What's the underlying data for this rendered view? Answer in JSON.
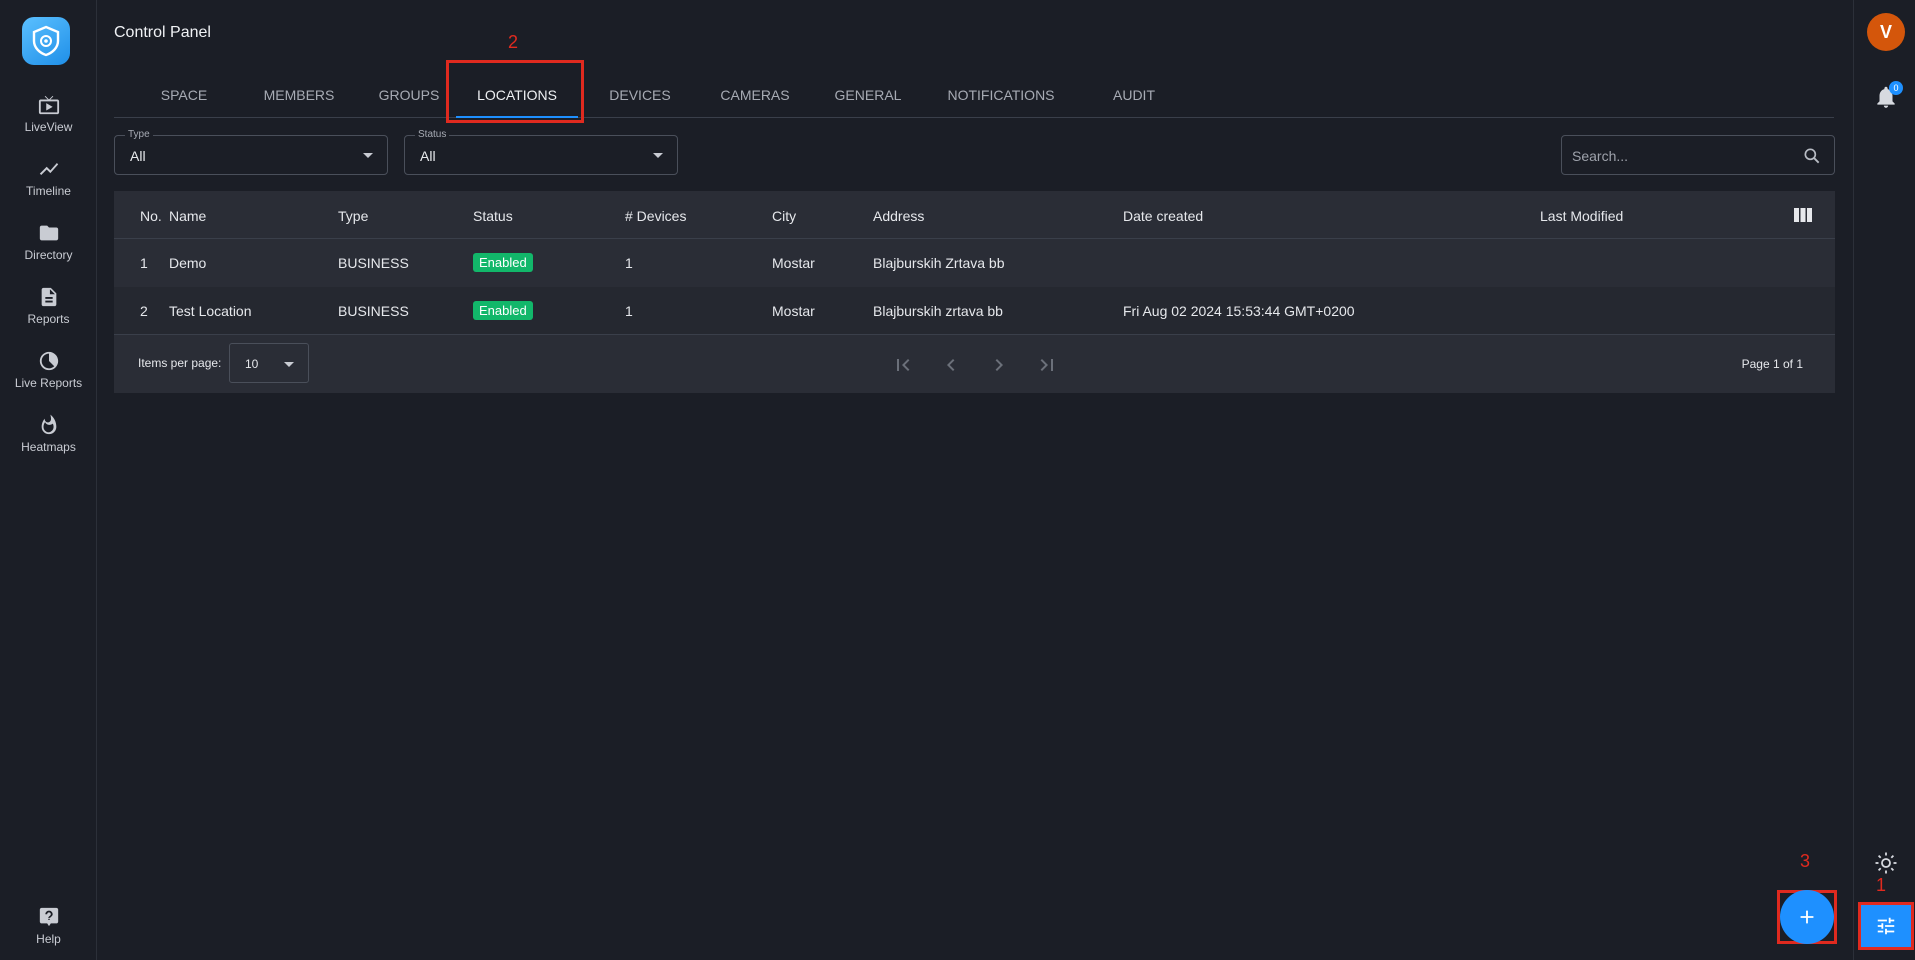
{
  "sidebar": {
    "items": [
      {
        "label": "LiveView",
        "icon": "tv-play-icon"
      },
      {
        "label": "Timeline",
        "icon": "trend-line-icon"
      },
      {
        "label": "Directory",
        "icon": "folder-icon"
      },
      {
        "label": "Reports",
        "icon": "document-icon"
      },
      {
        "label": "Live Reports",
        "icon": "live-report-icon"
      },
      {
        "label": "Heatmaps",
        "icon": "flame-icon"
      }
    ],
    "help_label": "Help"
  },
  "page": {
    "title": "Control Panel"
  },
  "tabs": [
    {
      "label": "SPACE"
    },
    {
      "label": "MEMBERS"
    },
    {
      "label": "GROUPS"
    },
    {
      "label": "LOCATIONS",
      "active": true
    },
    {
      "label": "DEVICES"
    },
    {
      "label": "CAMERAS"
    },
    {
      "label": "GENERAL"
    },
    {
      "label": "NOTIFICATIONS"
    },
    {
      "label": "AUDIT"
    }
  ],
  "annotations": {
    "one": "1",
    "two": "2",
    "three": "3"
  },
  "filters": {
    "type": {
      "label": "Type",
      "value": "All"
    },
    "status": {
      "label": "Status",
      "value": "All"
    }
  },
  "search": {
    "placeholder": "Search..."
  },
  "table": {
    "headers": {
      "no": "No.",
      "name": "Name",
      "type": "Type",
      "status": "Status",
      "devices": "# Devices",
      "city": "City",
      "address": "Address",
      "date_created": "Date created",
      "last_modified": "Last Modified"
    },
    "rows": [
      {
        "no": "1",
        "name": "Demo",
        "type": "BUSINESS",
        "status": "Enabled",
        "devices": "1",
        "city": "Mostar",
        "address": "Blajburskih Zrtava bb",
        "date_created": "",
        "last_modified": ""
      },
      {
        "no": "2",
        "name": "Test Location",
        "type": "BUSINESS",
        "status": "Enabled",
        "devices": "1",
        "city": "Mostar",
        "address": "Blajburskih zrtava bb",
        "date_created": "Fri Aug 02 2024 15:53:44 GMT+0200",
        "last_modified": ""
      }
    ],
    "footer": {
      "items_per_page_label": "Items per page:",
      "items_per_page": "10",
      "page_info": "Page 1 of 1"
    }
  },
  "user": {
    "initial": "V"
  },
  "notifications": {
    "count": "0"
  },
  "colors": {
    "accent": "#1e90ff",
    "enabled": "#12b76a",
    "avatar": "#d4560b",
    "annotation": "#e02a1f"
  }
}
